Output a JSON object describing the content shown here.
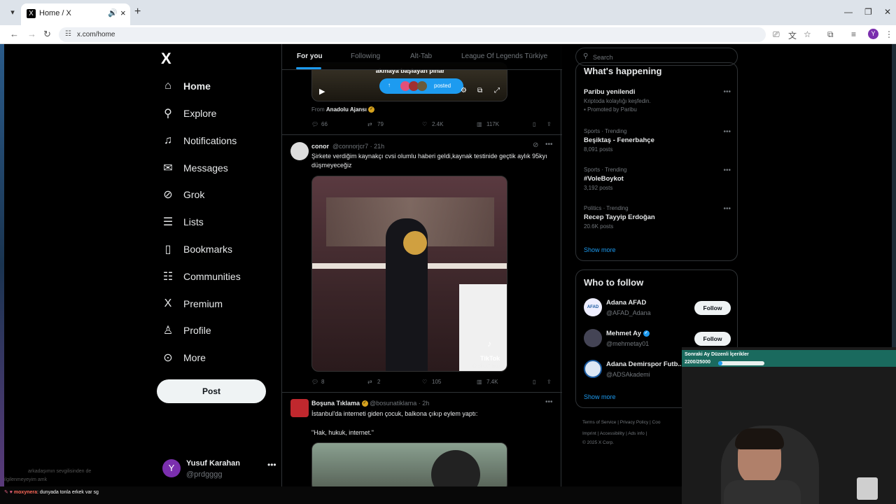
{
  "browser": {
    "tab_title": "Home / X",
    "tab_favicon": "X",
    "url": "x.com/home",
    "profile_initial": "Y"
  },
  "sidebar": {
    "logo": "X",
    "items": [
      {
        "label": "Home",
        "icon": "home-icon",
        "glyph": "⌂"
      },
      {
        "label": "Explore",
        "icon": "search-icon",
        "glyph": "⚲"
      },
      {
        "label": "Notifications",
        "icon": "bell-icon",
        "glyph": "♫"
      },
      {
        "label": "Messages",
        "icon": "mail-icon",
        "glyph": "✉"
      },
      {
        "label": "Grok",
        "icon": "grok-icon",
        "glyph": "⊘"
      },
      {
        "label": "Lists",
        "icon": "list-icon",
        "glyph": "☰"
      },
      {
        "label": "Bookmarks",
        "icon": "bookmark-icon",
        "glyph": "▯"
      },
      {
        "label": "Communities",
        "icon": "communities-icon",
        "glyph": "☷"
      },
      {
        "label": "Premium",
        "icon": "x-premium-icon",
        "glyph": "X"
      },
      {
        "label": "Profile",
        "icon": "person-icon",
        "glyph": "♙"
      },
      {
        "label": "More",
        "icon": "more-circle-icon",
        "glyph": "⊙"
      }
    ],
    "post_label": "Post",
    "account": {
      "initial": "Y",
      "name": "Yusuf Karahan",
      "handle": "@prdgggg"
    }
  },
  "feed": {
    "tabs": [
      "For you",
      "Following",
      "Alt-Tab",
      "League Of Legends Türkiye"
    ],
    "tweet1": {
      "caption": "akmaya başlayan pınar",
      "posted_label": "posted",
      "from_label": "From",
      "from_source": "Anadolu Ajansı",
      "replies": "66",
      "reposts": "79",
      "likes": "2.4K",
      "views": "117K"
    },
    "tweet2": {
      "name": "conor",
      "handle": "@connorjcr7 · 21h",
      "text": "Şirkete verdiğim kaynakçı cvsi olumlu haberi geldi,kaynak testinide geçtik aylık 95kyı düşmeyeceğiz",
      "tiktok_label": "TikTok",
      "tiktok_user": "@ slicx7.axp",
      "replies": "8",
      "reposts": "2",
      "likes": "105",
      "views": "7.4K"
    },
    "tweet3": {
      "name": "Boşuna Tıklama",
      "handle": "@bosunatiklama · 2h",
      "text": "İstanbul'da interneti giden çocuk, balkona çıkıp eylem yaptı:",
      "quote": "\"Hak, hukuk, internet.\""
    }
  },
  "right": {
    "search_placeholder": "Search",
    "happening_title": "What's happening",
    "trends": [
      {
        "meta": "",
        "title": "Paribu yenilendi",
        "sub": "Kriptoda kolaylığı keşfedin.",
        "sub2": "Promoted by Paribu"
      },
      {
        "meta": "Sports · Trending",
        "title": "Beşiktaş - Fenerbahçe",
        "sub": "8,091 posts",
        "sub2": ""
      },
      {
        "meta": "Sports · Trending",
        "title": "#VoleBoykot",
        "sub": "3,192 posts",
        "sub2": ""
      },
      {
        "meta": "Politics · Trending",
        "title": "Recep Tayyip Erdoğan",
        "sub": "20.6K posts",
        "sub2": ""
      }
    ],
    "show_more": "Show more",
    "who_title": "Who to follow",
    "follow_label": "Follow",
    "who": [
      {
        "name": "Adana AFAD",
        "handle": "@AFAD_Adana",
        "avatar": "AFAD"
      },
      {
        "name": "Mehmet Ay",
        "handle": "@mehmetay01",
        "avatar": ""
      },
      {
        "name": "Adana Demirspor Futb...",
        "handle": "@ADSAkademi",
        "avatar": ""
      }
    ],
    "footer": [
      "Terms of Service",
      "|",
      "Privacy Policy",
      "|",
      "Coo",
      "Imprint",
      "|",
      "Accessibility",
      "|",
      "Ads info",
      "|",
      "© 2025 X Corp."
    ]
  },
  "overlay": {
    "banner_title": "Sonraki Ay Düzenli İçerikler",
    "banner_progress": "2200/25000",
    "banner_fraction": 0.088,
    "chat_user": "moxynera",
    "chat_text": "dunyada tonla erkek var sg",
    "faded_line1": "arkadaşımın sevgilisinden de",
    "faded_line2": "ilgilenmeyeyim amk"
  }
}
